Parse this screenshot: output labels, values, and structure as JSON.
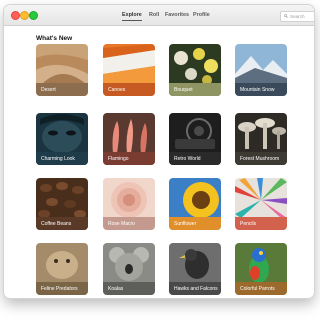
{
  "toolbar": {
    "tabs": [
      {
        "label": "Explore",
        "active": true
      },
      {
        "label": "Roll",
        "active": false
      },
      {
        "label": "Favorites",
        "active": false
      },
      {
        "label": "Profile",
        "active": false
      }
    ],
    "search": {
      "placeholder": "Search",
      "icon": "search-icon"
    }
  },
  "main": {
    "section_title": "What's New",
    "cards": [
      {
        "label": "Desert",
        "caption_color": "#8c6e4e"
      },
      {
        "label": "Canoes",
        "caption_color": "#c75a22"
      },
      {
        "label": "Bouquet",
        "caption_color": "#8f9463"
      },
      {
        "label": "Mountain Snow",
        "caption_color": "#3a4a5a"
      },
      {
        "label": "Charming Look",
        "caption_color": "#1f3c4a"
      },
      {
        "label": "Flamingo",
        "caption_color": "#7a3b31"
      },
      {
        "label": "Retro World",
        "caption_color": "#2a2a2a"
      },
      {
        "label": "Forest Mushroom",
        "caption_color": "#3d3a34"
      },
      {
        "label": "Coffee Beans",
        "caption_color": "#5a3a26"
      },
      {
        "label": "Rose Macro",
        "caption_color": "#c49a8f"
      },
      {
        "label": "Sunflower",
        "caption_color": "#e08f2b"
      },
      {
        "label": "Pencils",
        "caption_color": "#d2614d"
      },
      {
        "label": "Feline Predators",
        "caption_color": "#7a6546"
      },
      {
        "label": "Koalas",
        "caption_color": "#5e5e5a"
      },
      {
        "label": "Hawks and Falcons",
        "caption_color": "#494949"
      },
      {
        "label": "Colorful Parrots",
        "caption_color": "#9c6a2d"
      }
    ]
  }
}
